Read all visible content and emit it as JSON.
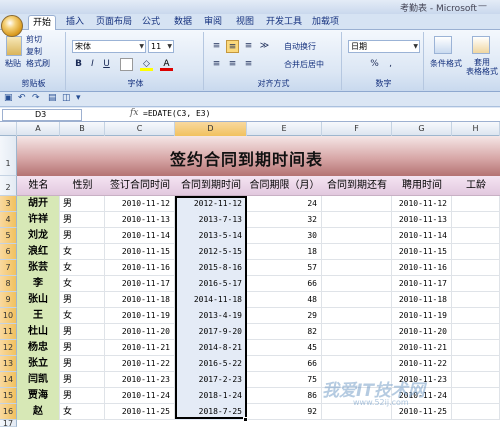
{
  "window": {
    "title": "考勤表 - Microsoft",
    "close_glyph": "—"
  },
  "tabs": [
    "开始",
    "插入",
    "页面布局",
    "公式",
    "数据",
    "审阅",
    "视图",
    "开发工具",
    "加载项"
  ],
  "ribbon": {
    "clipboard": {
      "paste": "粘贴",
      "cut": "剪切",
      "copy": "复制",
      "format_painter": "格式刷",
      "label": "剪贴板"
    },
    "font": {
      "name": "宋体",
      "size": "11",
      "label": "字体",
      "bold": "B",
      "italic": "I",
      "underline": "U"
    },
    "alignment": {
      "wrap": "自动换行",
      "merge": "合并后居中",
      "label": "对齐方式"
    },
    "number": {
      "format": "日期",
      "label": "数字",
      "percent": "%",
      "comma": ","
    },
    "styles": {
      "conditional": "条件格式",
      "table": "套用\n表格格式"
    }
  },
  "formula_bar": {
    "name_box": "D3",
    "fx": "fx",
    "formula": "=EDATE(C3, E3)"
  },
  "columns": [
    "A",
    "B",
    "C",
    "D",
    "E",
    "F",
    "G",
    "H"
  ],
  "sheet": {
    "title": "签约合同到期时间表",
    "headers": [
      "姓名",
      "性别",
      "签订合同时间",
      "合同到期时间",
      "合同期限（月）",
      "合同到期还有",
      "聘用时间",
      "工龄"
    ],
    "rows": [
      {
        "row": "3",
        "name": "胡开",
        "gender": "男",
        "signed": "2010-11-12",
        "expire": "2012-11-12",
        "months": "24",
        "hired": "2010-11-12"
      },
      {
        "row": "4",
        "name": "许祥",
        "gender": "男",
        "signed": "2010-11-13",
        "expire": "2013-7-13",
        "months": "32",
        "hired": "2010-11-13"
      },
      {
        "row": "5",
        "name": "刘龙",
        "gender": "男",
        "signed": "2010-11-14",
        "expire": "2013-5-14",
        "months": "30",
        "hired": "2010-11-14"
      },
      {
        "row": "6",
        "name": "浪红",
        "gender": "女",
        "signed": "2010-11-15",
        "expire": "2012-5-15",
        "months": "18",
        "hired": "2010-11-15"
      },
      {
        "row": "7",
        "name": "张芸",
        "gender": "女",
        "signed": "2010-11-16",
        "expire": "2015-8-16",
        "months": "57",
        "hired": "2010-11-16"
      },
      {
        "row": "8",
        "name": "李",
        "gender": "女",
        "signed": "2010-11-17",
        "expire": "2016-5-17",
        "months": "66",
        "hired": "2010-11-17"
      },
      {
        "row": "9",
        "name": "张山",
        "gender": "男",
        "signed": "2010-11-18",
        "expire": "2014-11-18",
        "months": "48",
        "hired": "2010-11-18"
      },
      {
        "row": "10",
        "name": "王",
        "gender": "女",
        "signed": "2010-11-19",
        "expire": "2013-4-19",
        "months": "29",
        "hired": "2010-11-19"
      },
      {
        "row": "11",
        "name": "杜山",
        "gender": "男",
        "signed": "2010-11-20",
        "expire": "2017-9-20",
        "months": "82",
        "hired": "2010-11-20"
      },
      {
        "row": "12",
        "name": "杨忠",
        "gender": "男",
        "signed": "2010-11-21",
        "expire": "2014-8-21",
        "months": "45",
        "hired": "2010-11-21"
      },
      {
        "row": "13",
        "name": "张立",
        "gender": "男",
        "signed": "2010-11-22",
        "expire": "2016-5-22",
        "months": "66",
        "hired": "2010-11-22"
      },
      {
        "row": "14",
        "name": "闫凯",
        "gender": "男",
        "signed": "2010-11-23",
        "expire": "2017-2-23",
        "months": "75",
        "hired": "2010-11-23"
      },
      {
        "row": "15",
        "name": "贾海",
        "gender": "男",
        "signed": "2010-11-24",
        "expire": "2018-1-24",
        "months": "86",
        "hired": "2010-11-24"
      },
      {
        "row": "16",
        "name": "赵",
        "gender": "女",
        "signed": "2010-11-25",
        "expire": "2018-7-25",
        "months": "92",
        "hired": "2010-11-25"
      }
    ]
  },
  "row_headers": {
    "title": "1",
    "header": "2",
    "last": "17"
  },
  "watermark": {
    "main": "我爱IT技术网",
    "sub": "www.52ij.com"
  }
}
